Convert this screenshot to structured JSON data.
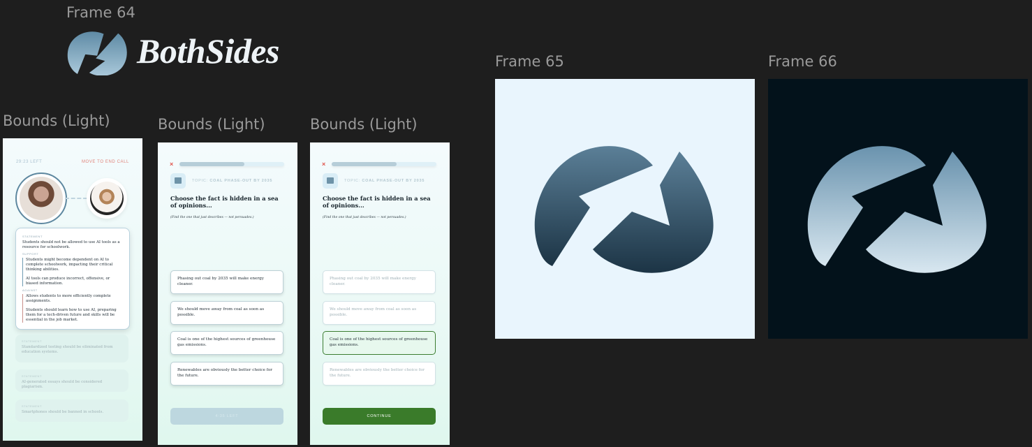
{
  "canvas": {
    "labels": {
      "frame64": "Frame 64",
      "bounds1": "Bounds (Light)",
      "bounds2": "Bounds (Light)",
      "bounds3": "Bounds (Light)",
      "frame65": "Frame 65",
      "frame66": "Frame 66"
    },
    "logo": {
      "wordmark": "BothSides",
      "mark_icon": "bothsides-logo-icon"
    },
    "colors": {
      "canvas_bg": "#1e1e1e",
      "logo_light": "#8fb3c8",
      "logo_dark": "#2f4d61",
      "frame65_bg": "#e9f5fd",
      "frame66_bg": "#03121b",
      "accent_green": "#3a7b2a",
      "accent_red": "#e0544b"
    }
  },
  "phone1": {
    "timer": "29:23 LEFT",
    "end_call": "MOVE TO END CALL",
    "active_card": {
      "statement_label": "STATEMENT",
      "statement": "Students should not be allowed to use AI tools as a resource for schoolwork.",
      "support_label": "SUPPORT",
      "support": [
        "Students might become dependent on AI to complete schoolwork, impacting their critical thinking abilities.",
        "AI tools can produce incorrect, offensive, or biased information."
      ],
      "against_label": "AGAINST",
      "against": [
        "Allows students to more efficiently complete assignments.",
        "Students should learn how to use AI, preparing them for a tech-driven future and skills will be essential in the job market."
      ]
    },
    "inactive_cards": [
      {
        "label": "STATEMENT",
        "text": "Standardized testing should be eliminated from education systems."
      },
      {
        "label": "STATEMENT",
        "text": "AI-generated essays should be considered plagiarism."
      },
      {
        "label": "STATEMENT",
        "text": "Smartphones should be banned in schools."
      }
    ]
  },
  "quiz": {
    "close": "×",
    "topic_prefix": "TOPIC:",
    "topic": "COAL PHASE-OUT BY 2035",
    "title": "Choose the fact is hidden in a sea of opinions...",
    "subtitle": "(Find the one that just describes — not persuades.)",
    "progress": 0.62,
    "options": [
      "Phasing out coal by 2035 will make energy cleaner.",
      "We should move away from coal as soon as possible.",
      "Coal is one of the highest sources of greenhouse gas emissions.",
      "Renewables are obviously the better choice for the future."
    ],
    "disabled_button": "4:35 LEFT",
    "continue_button": "CONTINUE",
    "selected_index": 2
  }
}
